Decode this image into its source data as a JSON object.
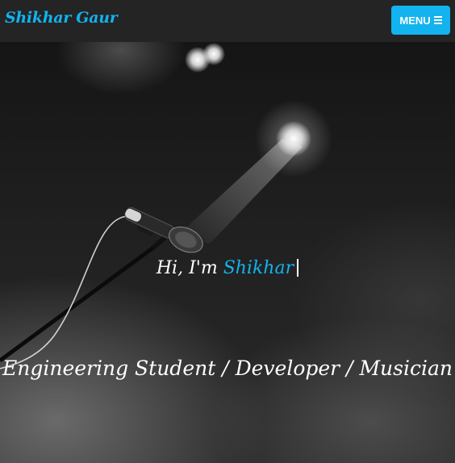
{
  "navbar": {
    "brand": "Shikhar Gaur",
    "menu_label": "MENU",
    "menu_icon": "hamburger-icon"
  },
  "hero": {
    "greeting_prefix": "Hi, I'm",
    "name": "Shikhar",
    "tagline": "Engineering Student / Developer / Musician",
    "background_image": "microphone-stage-photo"
  },
  "colors": {
    "accent": "#12b3ef",
    "navbar_bg": "#242424",
    "text": "#ffffff"
  }
}
